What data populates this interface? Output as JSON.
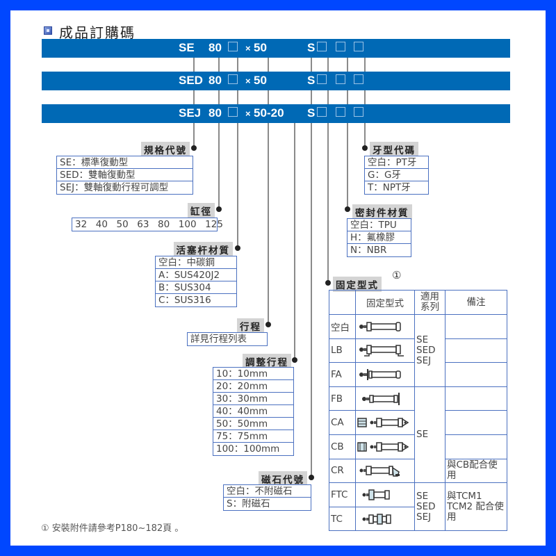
{
  "title": "成品訂購碼",
  "code_bars": [
    {
      "series": "SE",
      "bore": "80",
      "x": "×",
      "stroke": "50",
      "adj": "",
      "mag": "S"
    },
    {
      "series": "SED",
      "bore": "80",
      "x": "×",
      "stroke": "50",
      "adj": "",
      "mag": "S"
    },
    {
      "series": "SEJ",
      "bore": "80",
      "x": "×",
      "stroke": "50",
      "adj": "-20",
      "mag": "S"
    }
  ],
  "callouts": {
    "spec_code": {
      "header": "規格代號",
      "items": [
        "SE：標準復動型",
        "SED：雙軸復動型",
        "SEJ：雙軸復動行程可調型"
      ]
    },
    "bore": {
      "header": "缸徑",
      "items": [
        "32  40  50  63  80  100  125"
      ]
    },
    "rod_material": {
      "header": "活塞杆材質",
      "items": [
        "空白：中碳鋼",
        "A：SUS420J2",
        "B：SUS304",
        "C：SUS316"
      ]
    },
    "stroke": {
      "header": "行程",
      "items": [
        "詳見行程列表"
      ]
    },
    "adjust_stroke": {
      "header": "調整行程",
      "items": [
        "10：10mm",
        "20：20mm",
        "30：30mm",
        "40：40mm",
        "50：50mm",
        "75：75mm",
        "100：100mm"
      ]
    },
    "magnet": {
      "header": "磁石代號",
      "items": [
        "空白：不附磁石",
        "S：附磁石"
      ]
    },
    "thread": {
      "header": "牙型代碼",
      "items": [
        "空白：PT牙",
        "G：G牙",
        "T：NPT牙"
      ]
    },
    "seal": {
      "header": "密封件材質",
      "items": [
        "空白：TPU",
        "H：氟橡膠",
        "N：NBR"
      ]
    },
    "mounting": {
      "header": "固定型式",
      "footnote_mark": "①"
    }
  },
  "mount_table": {
    "headers": [
      "",
      "固定型式",
      "適用系列",
      "備注"
    ],
    "rows": [
      {
        "code": "空白",
        "icon": "basic-cylinder-icon"
      },
      {
        "code": "LB",
        "icon": "foot-mount-cylinder-icon"
      },
      {
        "code": "FA",
        "icon": "front-flange-cylinder-icon"
      },
      {
        "code": "FB",
        "icon": "rear-flange-cylinder-icon"
      },
      {
        "code": "CA",
        "icon": "single-clevis-cylinder-icon"
      },
      {
        "code": "CB",
        "icon": "double-clevis-cylinder-icon"
      },
      {
        "code": "CR",
        "icon": "clevis-bracket-cylinder-icon"
      },
      {
        "code": "FTC",
        "icon": "front-trunnion-cylinder-icon"
      },
      {
        "code": "TC",
        "icon": "center-trunnion-cylinder-icon"
      }
    ],
    "series_groups": [
      "SE\nSED\nSEJ",
      "SE",
      "SE\nSED\nSEJ"
    ],
    "remarks": {
      "CR": "與CB配合使用",
      "FTC_TC": "與TCM1 TCM2 配合使用"
    }
  },
  "footnote": "① 安裝附件請參考P180~182頁 。"
}
